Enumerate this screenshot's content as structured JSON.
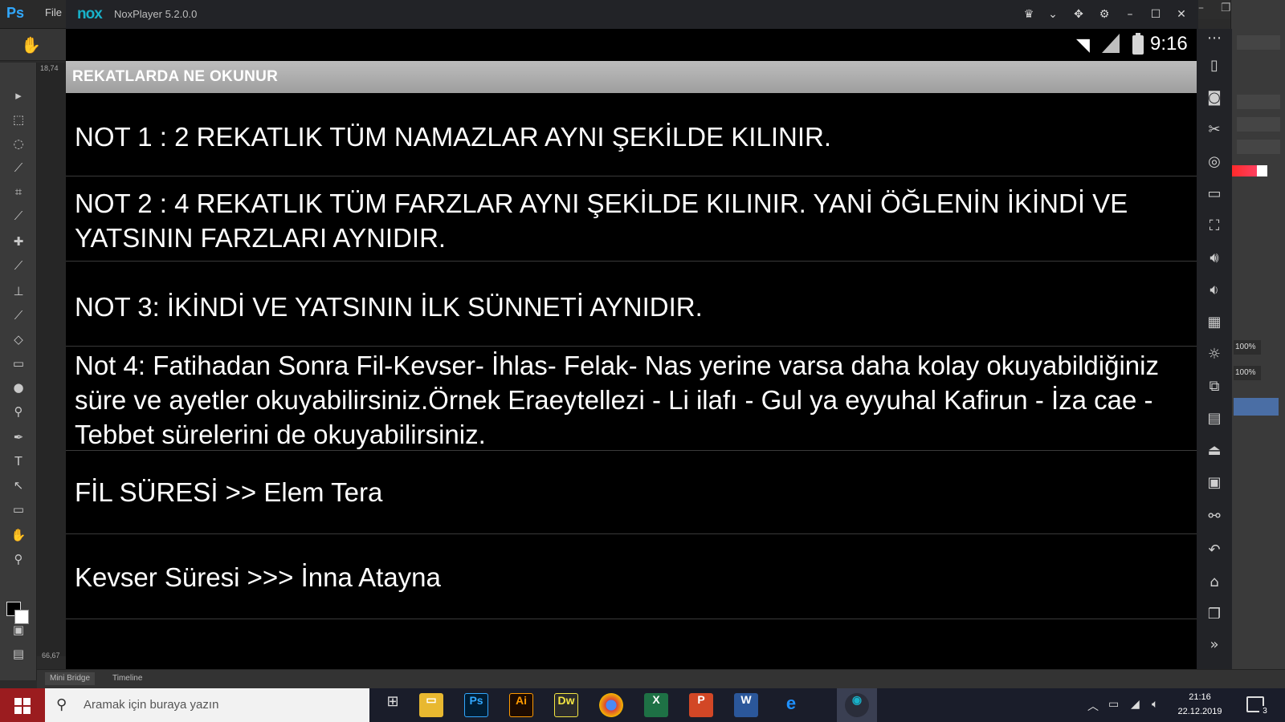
{
  "photoshop": {
    "logo": "Ps",
    "menu_file": "File",
    "zoom_readout": "18,74",
    "zoom_readout_bottom": "66,67",
    "layer_opacity": "100%",
    "layer_fill": "100%",
    "bottom_tabs": [
      "Mini Bridge",
      "Timeline"
    ]
  },
  "nox": {
    "logo": "nox",
    "version": "NoxPlayer 5.2.0.0"
  },
  "android": {
    "status_time": "9:16",
    "title": "REKATLARDA NE OKUNUR",
    "items": [
      "NOT 1 : 2 REKATLIK TÜM NAMAZLAR AYNI ŞEKİLDE KILINIR.",
      "NOT 2  : 4 REKATLIK TÜM FARZLAR AYNI ŞEKİLDE KILINIR. YANİ ÖĞLENİN İKİNDİ VE YATSININ FARZLARI AYNIDIR.",
      "NOT 3: İKİNDİ VE YATSININ İLK SÜNNETİ AYNIDIR.",
      "Not 4: Fatihadan Sonra Fil-Kevser- İhlas- Felak- Nas yerine varsa daha kolay okuyabildiğiniz süre ve ayetler okuyabilirsiniz.Örnek Eraeytellezi - Li ilafı - Gul ya eyyuhal Kafirun -  İza cae - Tebbet sürelerini de okuyabilirsiniz.",
      "FİL SÜRESİ >> Elem Tera",
      "Kevser Süresi >>> İnna Atayna"
    ]
  },
  "taskbar": {
    "search_placeholder": "Aramak için buraya yazın",
    "clock_time": "21:16",
    "clock_date": "22.12.2019",
    "notification_count": "3"
  },
  "colors": {
    "action_bar": "#b0b0b0",
    "android_bg": "#000000",
    "start_button": "#9b1c1f",
    "nox_brand": "#18b1c9"
  }
}
